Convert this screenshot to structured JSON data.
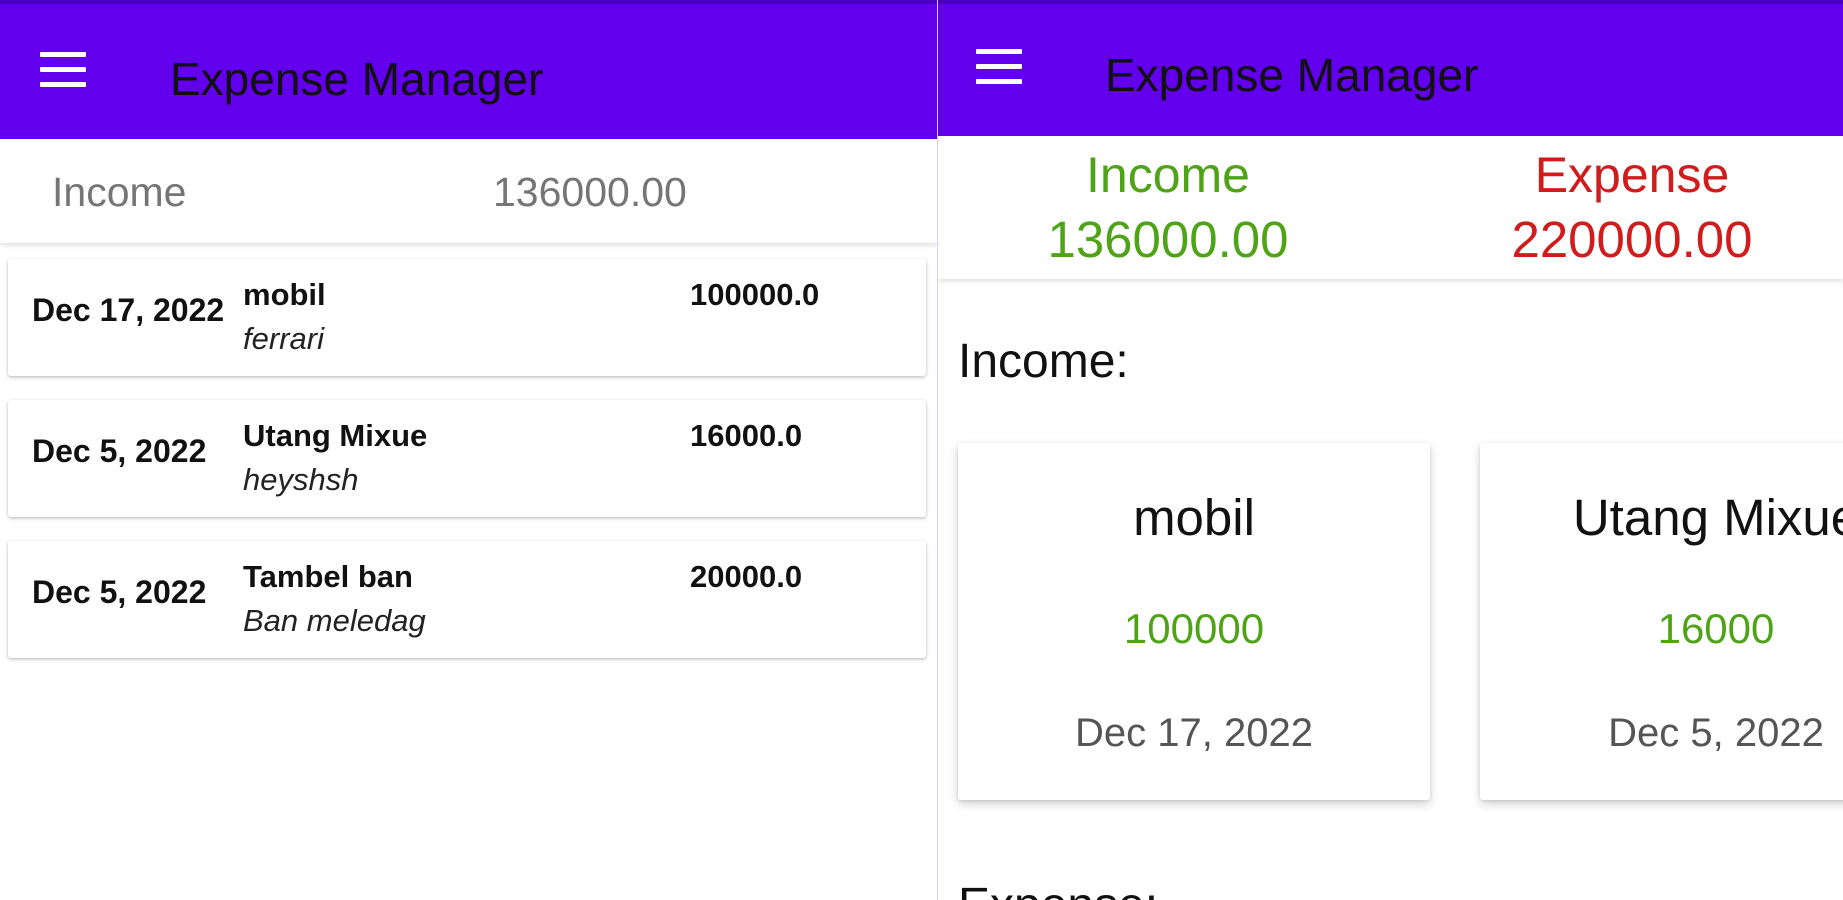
{
  "colors": {
    "app_bar": "#6200ee",
    "income": "#4fa317",
    "expense": "#d01c1c",
    "muted_text": "#757575"
  },
  "left_screen": {
    "app_bar": {
      "menu_icon": "hamburger-menu-icon",
      "title": "Expense Manager"
    },
    "summary": {
      "label": "Income",
      "value": "136000.00"
    },
    "transactions": [
      {
        "date": "Dec 17, 2022",
        "name": "mobil",
        "note": "ferrari",
        "amount": "100000.0"
      },
      {
        "date": "Dec 5, 2022",
        "name": "Utang Mixue",
        "note": "heyshsh",
        "amount": "16000.0"
      },
      {
        "date": "Dec 5, 2022",
        "name": "Tambel ban",
        "note": "Ban meledag",
        "amount": "20000.0"
      }
    ]
  },
  "right_screen": {
    "app_bar": {
      "menu_icon": "hamburger-menu-icon",
      "title": "Expense Manager"
    },
    "summary": {
      "income_label": "Income",
      "income_value": "136000.00",
      "expense_label": "Expense",
      "expense_value": "220000.00"
    },
    "income_heading": "Income:",
    "income_cards": [
      {
        "name": "mobil",
        "amount": "100000",
        "date": "Dec 17, 2022"
      },
      {
        "name": "Utang Mixue",
        "amount": "16000",
        "date": "Dec 5, 2022"
      }
    ],
    "expense_heading": "Expense:"
  }
}
